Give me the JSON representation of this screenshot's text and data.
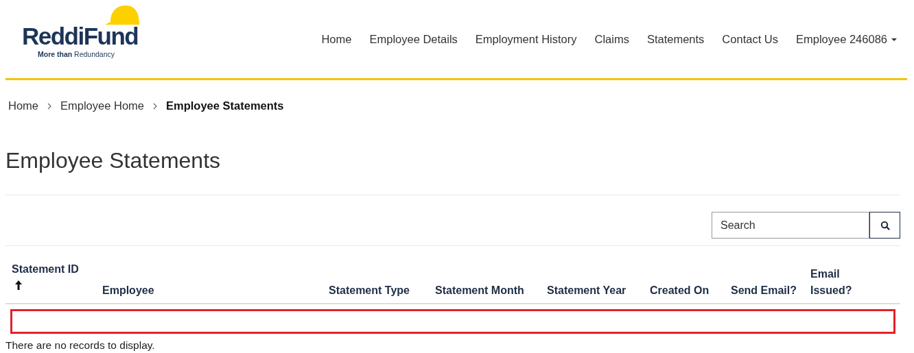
{
  "logo": {
    "name": "ReddiFund",
    "tagline": "**More than** Redundancy"
  },
  "nav": [
    {
      "label": "Home",
      "kind": "link"
    },
    {
      "label": "Employee Details",
      "kind": "link"
    },
    {
      "label": "Employment History",
      "kind": "link"
    },
    {
      "label": "Claims",
      "kind": "link"
    },
    {
      "label": "Statements",
      "kind": "link"
    },
    {
      "label": "Contact Us",
      "kind": "link"
    },
    {
      "label": "Employee 246086",
      "kind": "dropdown"
    }
  ],
  "breadcrumb": [
    {
      "label": "Home",
      "current": false
    },
    {
      "label": "Employee Home",
      "current": false
    },
    {
      "label": "Employee Statements",
      "current": true
    }
  ],
  "page_title": "Employee Statements",
  "search": {
    "placeholder": "Search"
  },
  "table": {
    "columns": [
      {
        "label": "Statement ID",
        "sorted": true
      },
      {
        "label": "Employee",
        "sorted": false
      },
      {
        "label": "Statement Type",
        "sorted": false
      },
      {
        "label": "Statement Month",
        "sorted": false
      },
      {
        "label": "Statement Year",
        "sorted": false
      },
      {
        "label": "Created On",
        "sorted": false
      },
      {
        "label": "Send Email?",
        "sorted": false
      },
      {
        "label": "Email Issued?",
        "sorted": false
      }
    ],
    "empty_message": "There are no records to display."
  }
}
